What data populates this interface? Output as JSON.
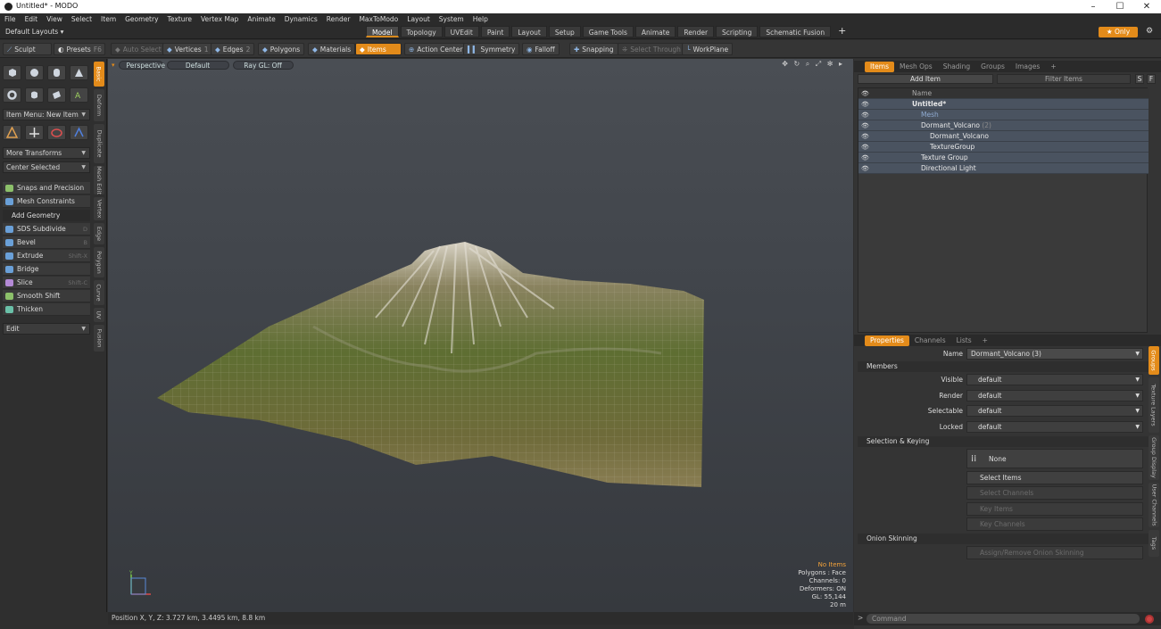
{
  "window": {
    "title": "Untitled* - MODO",
    "minimize": "–",
    "maximize": "☐",
    "close": "✕"
  },
  "menu": [
    "File",
    "Edit",
    "View",
    "Select",
    "Item",
    "Geometry",
    "Texture",
    "Vertex Map",
    "Animate",
    "Dynamics",
    "Render",
    "MaxToModo",
    "Layout",
    "System",
    "Help"
  ],
  "layoutbar": {
    "layout": "Default Layouts ▾",
    "tabs": [
      "Model",
      "Topology",
      "UVEdit",
      "Paint",
      "Layout",
      "Setup",
      "Game Tools",
      "Animate",
      "Render",
      "Scripting",
      "Schematic Fusion"
    ],
    "active_tab": "Model",
    "plus": "+",
    "only": "★ Only",
    "gear": "⚙"
  },
  "toolbar": {
    "sculpt": "Sculpt",
    "presets": "Presets",
    "presets_key": "F6",
    "auto_select": "Auto Select",
    "vertices": "Vertices",
    "vertices_key": "1",
    "edges": "Edges",
    "edges_key": "2",
    "polygons": "Polygons",
    "materials": "Materials",
    "items": "Items",
    "action_center": "Action Center",
    "symmetry": "Symmetry",
    "falloff": "Falloff",
    "snapping": "Snapping",
    "select_through": "Select Through",
    "workplane": "WorkPlane"
  },
  "left": {
    "vtabs": [
      "Basic",
      "Deform",
      "Duplicate",
      "Mesh Edit",
      "Vertex",
      "Edge",
      "Polygon",
      "Curve",
      "UV",
      "Fusion"
    ],
    "item_menu": "Item Menu: New Item",
    "more_transforms": "More Transforms",
    "center_selected": "Center Selected",
    "snaps": "Snaps and Precision",
    "mesh_constraints": "Mesh Constraints",
    "add_geometry": "Add Geometry",
    "tools": [
      {
        "label": "SDS Subdivide",
        "key": "D",
        "color": "#6aa0d8"
      },
      {
        "label": "Bevel",
        "key": "B",
        "color": "#6aa0d8"
      },
      {
        "label": "Extrude",
        "key": "Shift-X",
        "color": "#6aa0d8"
      },
      {
        "label": "Bridge",
        "key": "",
        "color": "#6aa0d8"
      },
      {
        "label": "Slice",
        "key": "Shift-C",
        "color": "#b48ad6"
      },
      {
        "label": "Smooth Shift",
        "key": "",
        "color": "#8cc06a"
      },
      {
        "label": "Thicken",
        "key": "",
        "color": "#6ac0a8"
      }
    ],
    "edit": "Edit"
  },
  "viewport": {
    "view": "Perspective",
    "shading": "Default",
    "raygl": "Ray GL: Off",
    "icons": "✥ ↻ ⌕ ⤢ ✻ ▸",
    "stats": {
      "no_items": "No Items",
      "polygons": "Polygons : Face",
      "channels": "Channels: 0",
      "deformers": "Deformers: ON",
      "gl": "GL: 55,144",
      "scale": "20 m"
    },
    "axis_y": "Y"
  },
  "status": "Position X, Y, Z:  3.727 km, 3.4495 km, 8.8 km",
  "right": {
    "tabs": [
      "Items",
      "Mesh Ops",
      "Shading",
      "Groups",
      "Images",
      "+"
    ],
    "active_tab": "Items",
    "add_item": "Add Item",
    "filter": "Filter Items",
    "s_btn": "S",
    "f_btn": "F",
    "name_col": "Name",
    "tree": [
      {
        "label": "Untitled*",
        "count": "",
        "bold": true,
        "indent": 0
      },
      {
        "label": "Mesh",
        "count": "",
        "dim": true,
        "indent": 1
      },
      {
        "label": "Dormant_Volcano",
        "count": "(2)",
        "indent": 1
      },
      {
        "label": "Dormant_Volcano",
        "count": "",
        "indent": 2
      },
      {
        "label": "TextureGroup",
        "count": "",
        "indent": 2
      },
      {
        "label": "Texture Group",
        "count": "",
        "indent": 1
      },
      {
        "label": "Directional Light",
        "count": "",
        "indent": 1
      }
    ],
    "props_tabs": [
      "Properties",
      "Channels",
      "Lists",
      "+"
    ],
    "props_active": "Properties",
    "name_label": "Name",
    "name_value": "Dormant_Volcano (3)",
    "members": "Members",
    "fields": [
      {
        "k": "Visible",
        "v": "default"
      },
      {
        "k": "Render",
        "v": "default"
      },
      {
        "k": "Selectable",
        "v": "default"
      },
      {
        "k": "Locked",
        "v": "default"
      }
    ],
    "selection_keying": "Selection & Keying",
    "none": "None",
    "select_items": "Select Items",
    "select_channels": "Select Channels",
    "key_items": "Key Items",
    "key_channels": "Key Channels",
    "onion": "Onion Skinning",
    "assign_onion": "Assign/Remove Onion Skinning",
    "vtabs": [
      "Groups",
      "Texture Layers",
      "Group Display",
      "User Channels",
      "Tags"
    ],
    "command_placeholder": "Command"
  },
  "colors": {
    "accent": "#e38b1a"
  }
}
